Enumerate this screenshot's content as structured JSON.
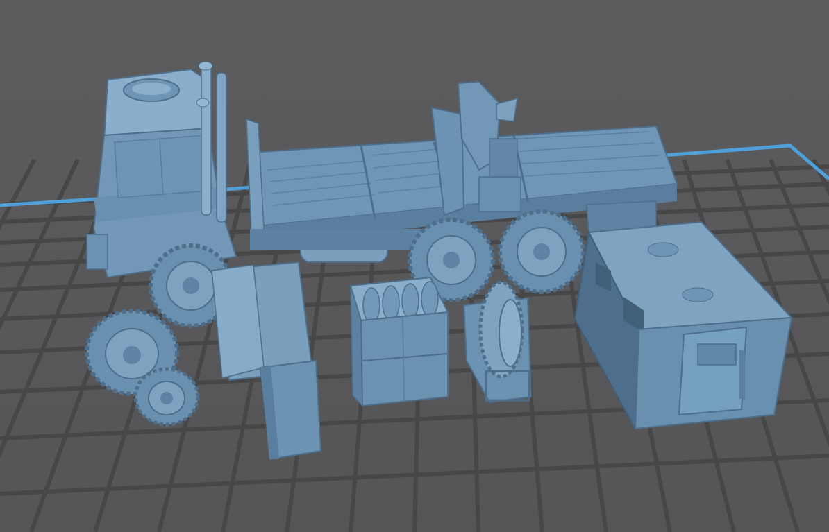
{
  "viewport": {
    "background_color": "#5a5a5c",
    "grid_color": "#484849",
    "plate_line_color": "#474748",
    "boundary_color": "#4f9fd8",
    "model_color": "#6c93b3",
    "model_light_color": "#87acc9",
    "model_dark_color": "#4d6f8c"
  },
  "objects": [
    "flatbed-truck",
    "spare-wheel-large",
    "spare-wheel-small",
    "panel-cabinet",
    "tank-crate",
    "wheel-frame",
    "container-shelter"
  ]
}
